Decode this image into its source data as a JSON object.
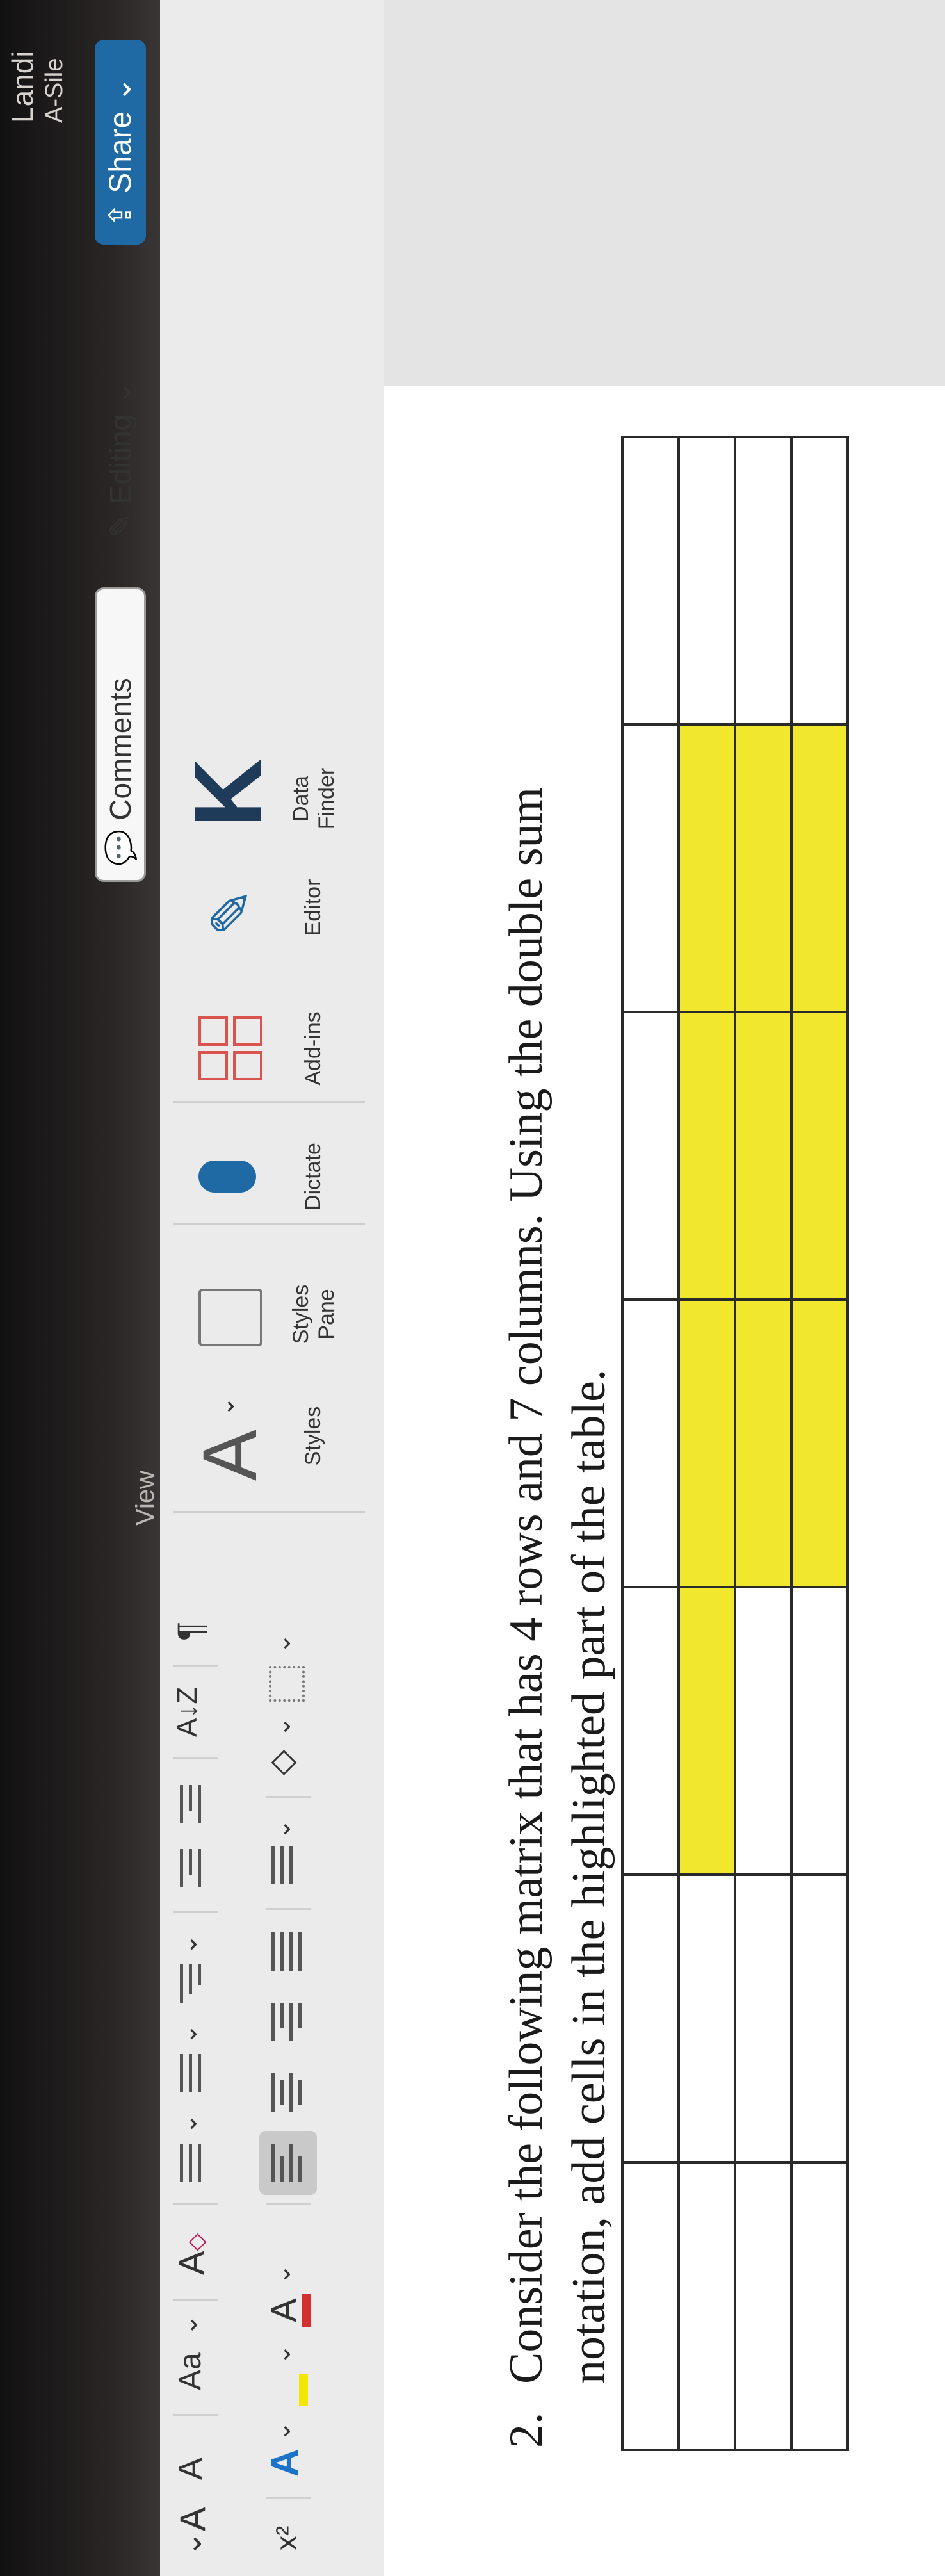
{
  "ribbon": {
    "view_tab": "View",
    "font_grow": "A",
    "font_shrink": "A",
    "change_case": "Aa",
    "superscript": "x²",
    "sort": "A↓Z",
    "pilcrow": "¶",
    "styles_label": "Styles",
    "styles_pane_label": "Styles Pane",
    "dictate_label": "Dictate",
    "addins_label": "Add-ins",
    "editor_label": "Editor",
    "data_finder_label": "Data Finder",
    "comments_label": "Comments",
    "editing_label": "Editing",
    "share_label": "Share",
    "corner_text_1": "Landi",
    "corner_text_2": "A-Sile",
    "colors": {
      "highlight": "#f2e700",
      "font_color": "#d32f2f",
      "share_bg": "#1f6aa5"
    },
    "icons": [
      "text-highlight-icon",
      "bullets-icon",
      "numbering-icon",
      "multilevel-list-icon",
      "decrease-indent-icon",
      "increase-indent-icon",
      "align-left-icon",
      "align-center-icon",
      "align-right-icon",
      "justify-icon",
      "line-spacing-icon",
      "shading-icon",
      "borders-icon",
      "microphone-icon",
      "addins-grid-icon",
      "editor-pen-icon",
      "data-finder-k-icon",
      "pencil-icon",
      "comment-icon",
      "share-icon"
    ]
  },
  "document": {
    "number": "2.",
    "line1": "Consider the following matrix that has 4 rows and 7 columns. Using the double sum",
    "line2": "notation, add cells in the highlighted part of the table.",
    "table": {
      "rows": 4,
      "cols": 7,
      "highlight_color": "#f1e72d",
      "highlight": [
        [
          false,
          false,
          false,
          false,
          false,
          false,
          false
        ],
        [
          false,
          false,
          true,
          true,
          true,
          true,
          false
        ],
        [
          false,
          false,
          false,
          true,
          true,
          true,
          false
        ],
        [
          false,
          false,
          false,
          true,
          true,
          true,
          false
        ]
      ]
    }
  }
}
